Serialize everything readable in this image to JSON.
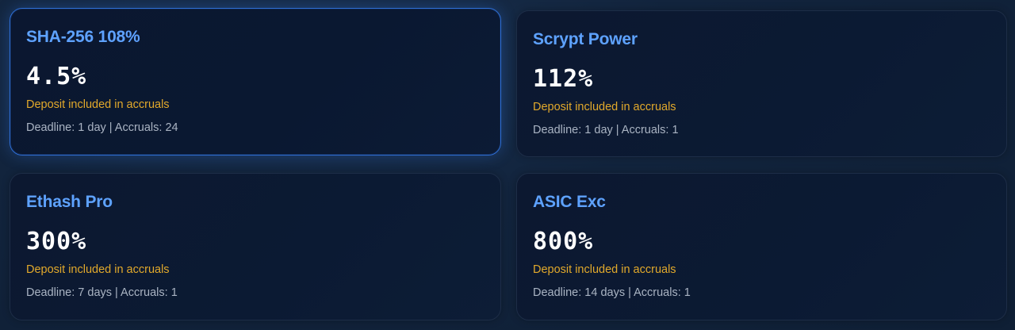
{
  "plans": [
    {
      "title": "SHA-256 108%",
      "rate": "4.5%",
      "deposit_note": "Deposit included in accruals",
      "meta": "Deadline: 1 day | Accruals: 24",
      "selected": true
    },
    {
      "title": "Scrypt Power",
      "rate": "112%",
      "deposit_note": "Deposit included in accruals",
      "meta": "Deadline: 1 day | Accruals: 1",
      "selected": false
    },
    {
      "title": "Ethash Pro",
      "rate": "300%",
      "deposit_note": "Deposit included in accruals",
      "meta": "Deadline: 7 days | Accruals: 1",
      "selected": false
    },
    {
      "title": "ASIC Exc",
      "rate": "800%",
      "deposit_note": "Deposit included in accruals",
      "meta": "Deadline: 14 days | Accruals: 1",
      "selected": false
    }
  ],
  "colors": {
    "title": "#5ea2ff",
    "value": "#ffffff",
    "deposit": "#e2a92b",
    "meta": "#aab4c3",
    "active_border": "#2f6fd6"
  }
}
